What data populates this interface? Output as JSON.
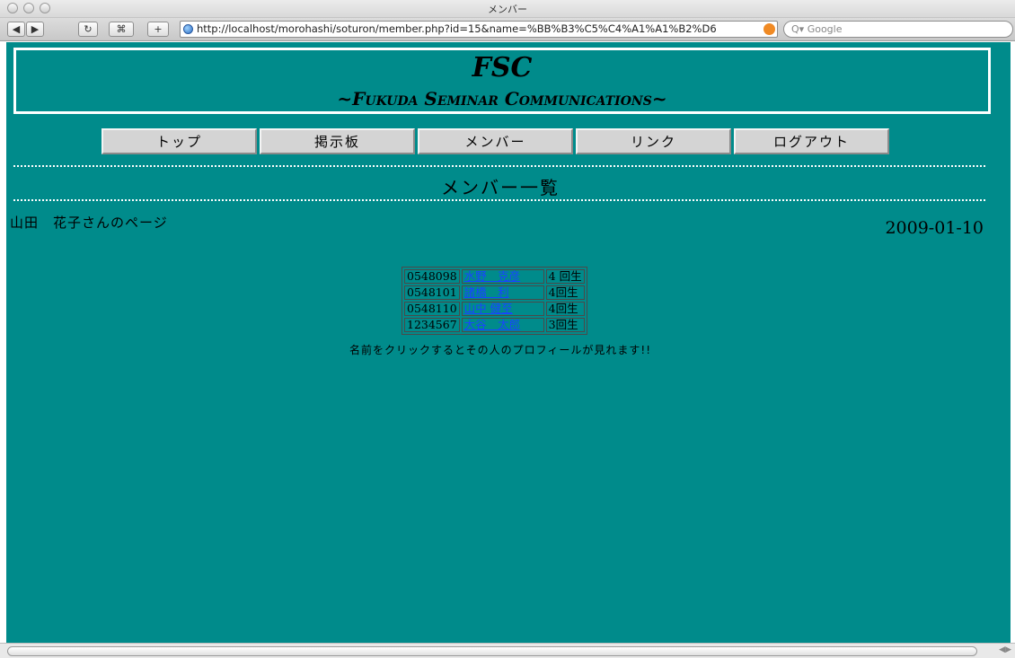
{
  "window": {
    "title": "メンバー"
  },
  "toolbar": {
    "back": "◀",
    "forward": "▶",
    "reload": "↻",
    "bookmark": "⌘",
    "add": "+",
    "url": "http://localhost/morohashi/soturon/member.php?id=15&name=%BB%B3%C5%C4%A1%A1%B2%D6",
    "search_placeholder": "Google"
  },
  "header": {
    "title": "FSC",
    "subtitle": "~Fukuda Seminar Communications~"
  },
  "nav": {
    "items": [
      {
        "label": "トップ"
      },
      {
        "label": "掲示板"
      },
      {
        "label": "メンバー"
      },
      {
        "label": "リンク"
      },
      {
        "label": "ログアウト"
      }
    ]
  },
  "main": {
    "section_title": "メンバー一覧",
    "user_page_label": "山田　花子さんのページ",
    "date": "2009-01-10",
    "members": [
      {
        "id": "0548098",
        "name": "水野　克彦",
        "grade": "4 回生"
      },
      {
        "id": "0548101",
        "name": "諸橋　利",
        "grade": "4回生"
      },
      {
        "id": "0548110",
        "name": "山中 健至",
        "grade": "4回生"
      },
      {
        "id": "1234567",
        "name": "大谷　太郎",
        "grade": "3回生"
      }
    ],
    "note": "名前をクリックするとその人のプロフィールが見れます!!"
  },
  "colors": {
    "page_background": "#008b8b",
    "link": "#1a44ff",
    "nav_button": "#d4d4d4"
  }
}
